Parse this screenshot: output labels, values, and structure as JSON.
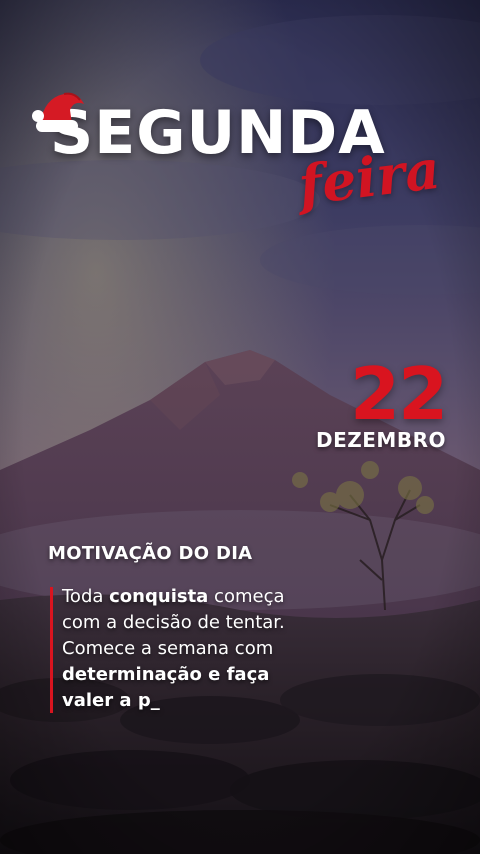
{
  "title": {
    "main": "SEGUNDA",
    "script": "feira"
  },
  "date": {
    "day": "22",
    "month": "DEZEMBRO"
  },
  "quote": {
    "heading": "MOTIVAÇÃO DO DIA",
    "line1_a": "Toda ",
    "line1_b": "conquista",
    "line1_c": " começa",
    "line2": "com a decisão de tentar.",
    "line3": "Comece a semana com",
    "line4": "determinação e faça",
    "line5": "valer a p_"
  },
  "colors": {
    "accent_red": "#d9141f",
    "text_white": "#ffffff"
  },
  "icons": {
    "hat": "santa-hat-icon"
  }
}
